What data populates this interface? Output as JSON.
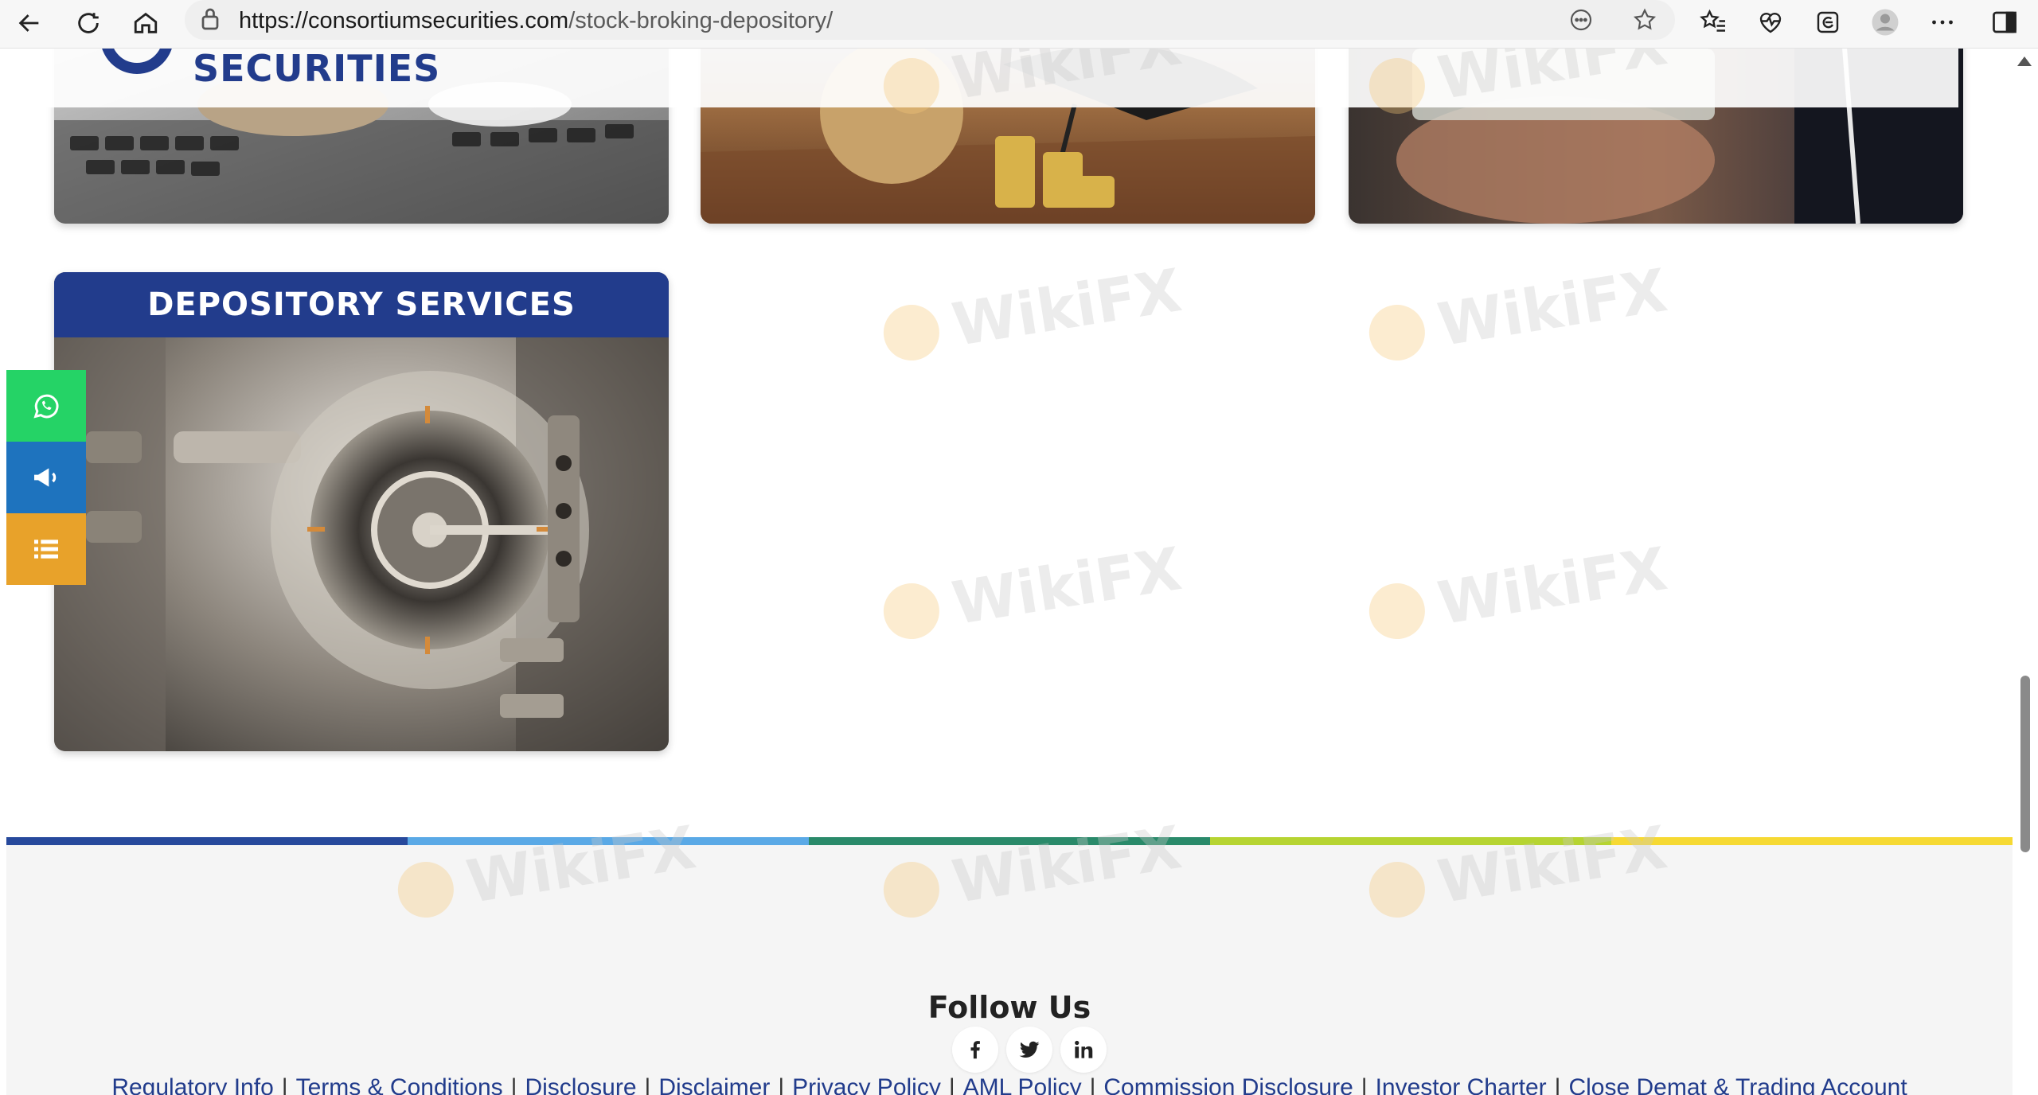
{
  "browser": {
    "url_host": "https://consortiumsecurities.com",
    "url_path": "/stock-broking-depository/"
  },
  "site": {
    "logo_text": "SECURITIES"
  },
  "cards": {
    "depository_title": "DEPOSITORY SERVICES"
  },
  "watermark": "WikiFX",
  "footer": {
    "follow_title": "Follow Us",
    "social": [
      "facebook-icon",
      "twitter-icon",
      "linkedin-icon"
    ],
    "links": [
      "Regulatory Info",
      "Terms & Conditions",
      "Disclosure",
      "Disclaimer",
      "Privacy Policy",
      "AML Policy",
      "Commission Disclosure",
      "Investor Charter",
      "Close Demat & Trading Account"
    ],
    "separator": "|"
  },
  "colors": {
    "brand_blue": "#223c8c",
    "whatsapp_green": "#25d366",
    "announce_blue": "#1e73be",
    "menu_orange": "#e8a22a",
    "bar": [
      "#27499c",
      "#5aa9e6",
      "#2a8a6a",
      "#b6d432",
      "#f6d933"
    ]
  }
}
